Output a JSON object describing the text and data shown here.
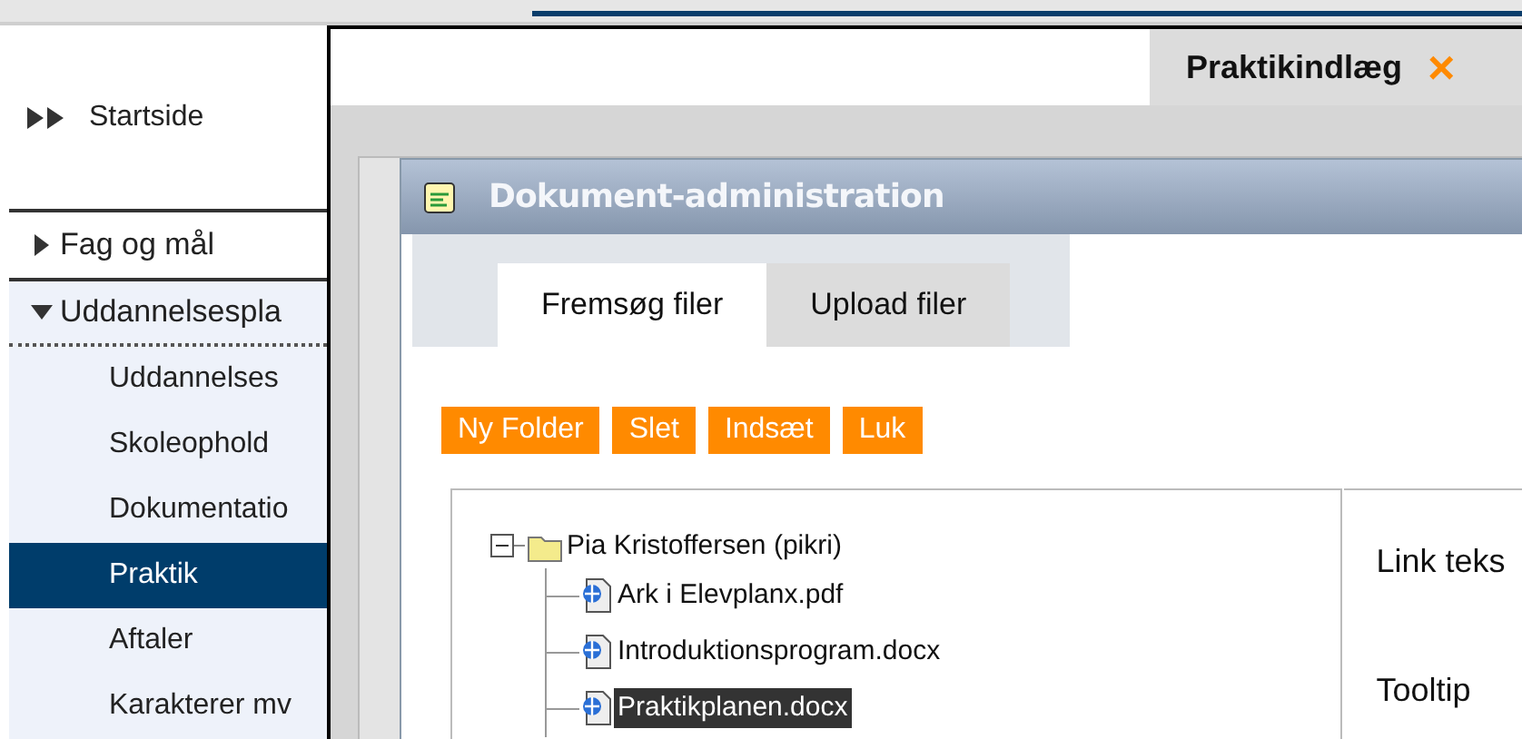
{
  "sidebar": {
    "home": "Startside",
    "sections": [
      {
        "label": "Fag og mål",
        "expanded": false
      },
      {
        "label": "Uddannelsespla",
        "expanded": true,
        "children": [
          {
            "label": "Uddannelses",
            "selected": false
          },
          {
            "label": "Skoleophold",
            "selected": false
          },
          {
            "label": "Dokumentatio",
            "selected": false
          },
          {
            "label": "Praktik",
            "selected": true
          },
          {
            "label": "Aftaler",
            "selected": false
          },
          {
            "label": "Karakterer mv",
            "selected": false
          }
        ]
      }
    ]
  },
  "main_tab": {
    "label": "Praktikindlæg",
    "close": "×"
  },
  "dialog": {
    "title": "Dokument-administration",
    "tabs": [
      {
        "label": "Fremsøg filer",
        "selected": true
      },
      {
        "label": "Upload filer",
        "selected": false
      }
    ],
    "buttons": [
      "Ny Folder",
      "Slet",
      "Indsæt",
      "Luk"
    ],
    "tree": {
      "label": "Pia Kristoffersen (pikri)",
      "expanded": true,
      "children": [
        {
          "label": "Ark i Elevplanx.pdf",
          "selected": false
        },
        {
          "label": "Introduktionsprogram.docx",
          "selected": false
        },
        {
          "label": "Praktikplanen.docx",
          "selected": true
        }
      ]
    },
    "fields": [
      "Link teks",
      "Tooltip"
    ]
  }
}
